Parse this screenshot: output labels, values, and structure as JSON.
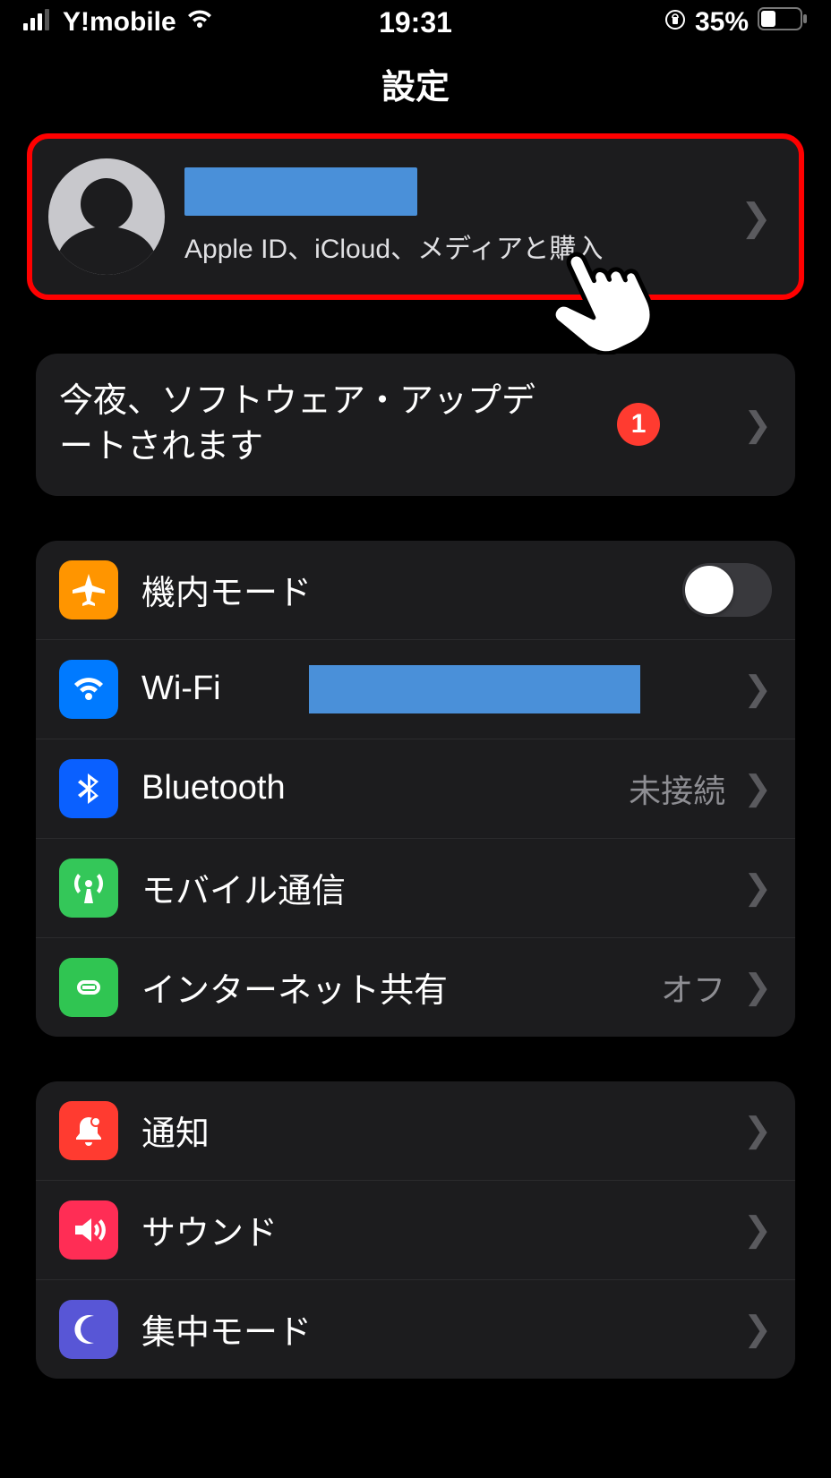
{
  "status": {
    "carrier": "Y!mobile",
    "time": "19:31",
    "battery_pct": "35%"
  },
  "header": {
    "title": "設定"
  },
  "profile": {
    "name_redacted": true,
    "subtitle": "Apple ID、iCloud、メディアと購入"
  },
  "update": {
    "label": "今夜、ソフトウェア・アップデートされます",
    "badge": "1"
  },
  "group1": {
    "items": [
      {
        "label": "機内モード",
        "icon": "airplane",
        "toggle": false
      },
      {
        "label": "Wi-Fi",
        "icon": "wifi",
        "value_redacted": true
      },
      {
        "label": "Bluetooth",
        "icon": "bluetooth",
        "value": "未接続"
      },
      {
        "label": "モバイル通信",
        "icon": "antenna"
      },
      {
        "label": "インターネット共有",
        "icon": "link",
        "value": "オフ"
      }
    ]
  },
  "group2": {
    "items": [
      {
        "label": "通知",
        "icon": "bell"
      },
      {
        "label": "サウンド",
        "icon": "sound"
      },
      {
        "label": "集中モード",
        "icon": "moon"
      }
    ]
  }
}
